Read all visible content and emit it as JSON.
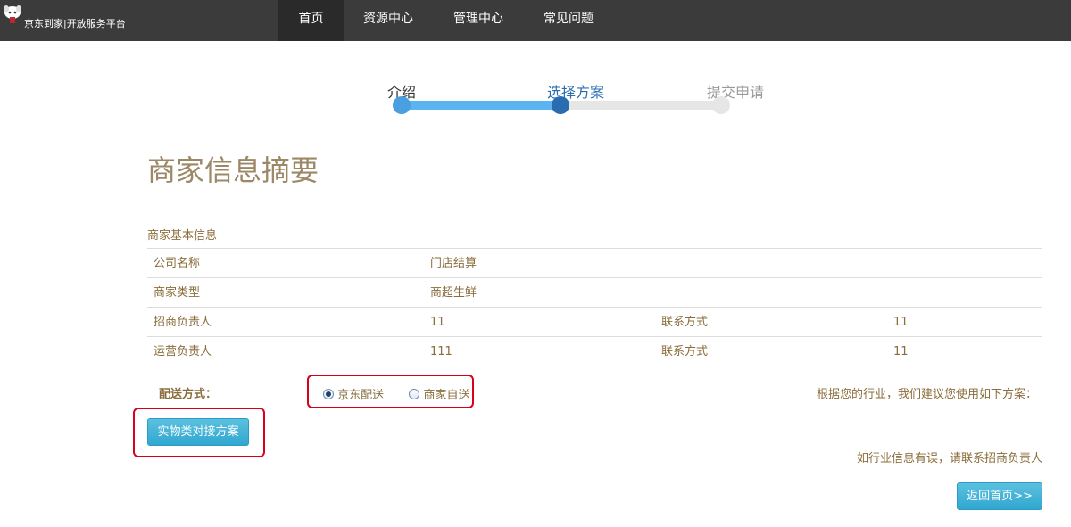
{
  "brand": {
    "name": "京东到家|开放服务平台"
  },
  "nav": [
    {
      "label": "首页",
      "active": true
    },
    {
      "label": "资源中心",
      "active": false
    },
    {
      "label": "管理中心",
      "active": false
    },
    {
      "label": "常见问题",
      "active": false
    }
  ],
  "stepper": {
    "steps": [
      {
        "label": "介绍",
        "state": "done"
      },
      {
        "label": "选择方案",
        "state": "current"
      },
      {
        "label": "提交申请",
        "state": "pending"
      }
    ],
    "colors": {
      "done": "#4a9fe0",
      "current": "#2a6cb0",
      "pending": "#e6e6e6",
      "bar_done": "#5ab4f0"
    }
  },
  "page_title": "商家信息摘要",
  "section_label": "商家基本信息",
  "info_table": [
    {
      "label": "公司名称",
      "value": "门店结算"
    },
    {
      "label": "商家类型",
      "value": "商超生鲜"
    },
    {
      "label": "招商负责人",
      "value": "11",
      "label2": "联系方式",
      "value2": "11"
    },
    {
      "label": "运营负责人",
      "value": "111",
      "label2": "联系方式",
      "value2": "11"
    }
  ],
  "delivery": {
    "label": "配送方式：",
    "options": [
      {
        "label": "京东配送",
        "checked": true
      },
      {
        "label": "商家自送",
        "checked": false
      }
    ]
  },
  "suggestion_text": "根据您的行业，我们建议您使用如下方案：",
  "plan_button": "实物类对接方案",
  "contact_note": "如行业信息有误，请联系招商负责人",
  "back_button": "返回首页>>",
  "accent_color": "#5bc0de",
  "highlight_color": "#d9001b"
}
